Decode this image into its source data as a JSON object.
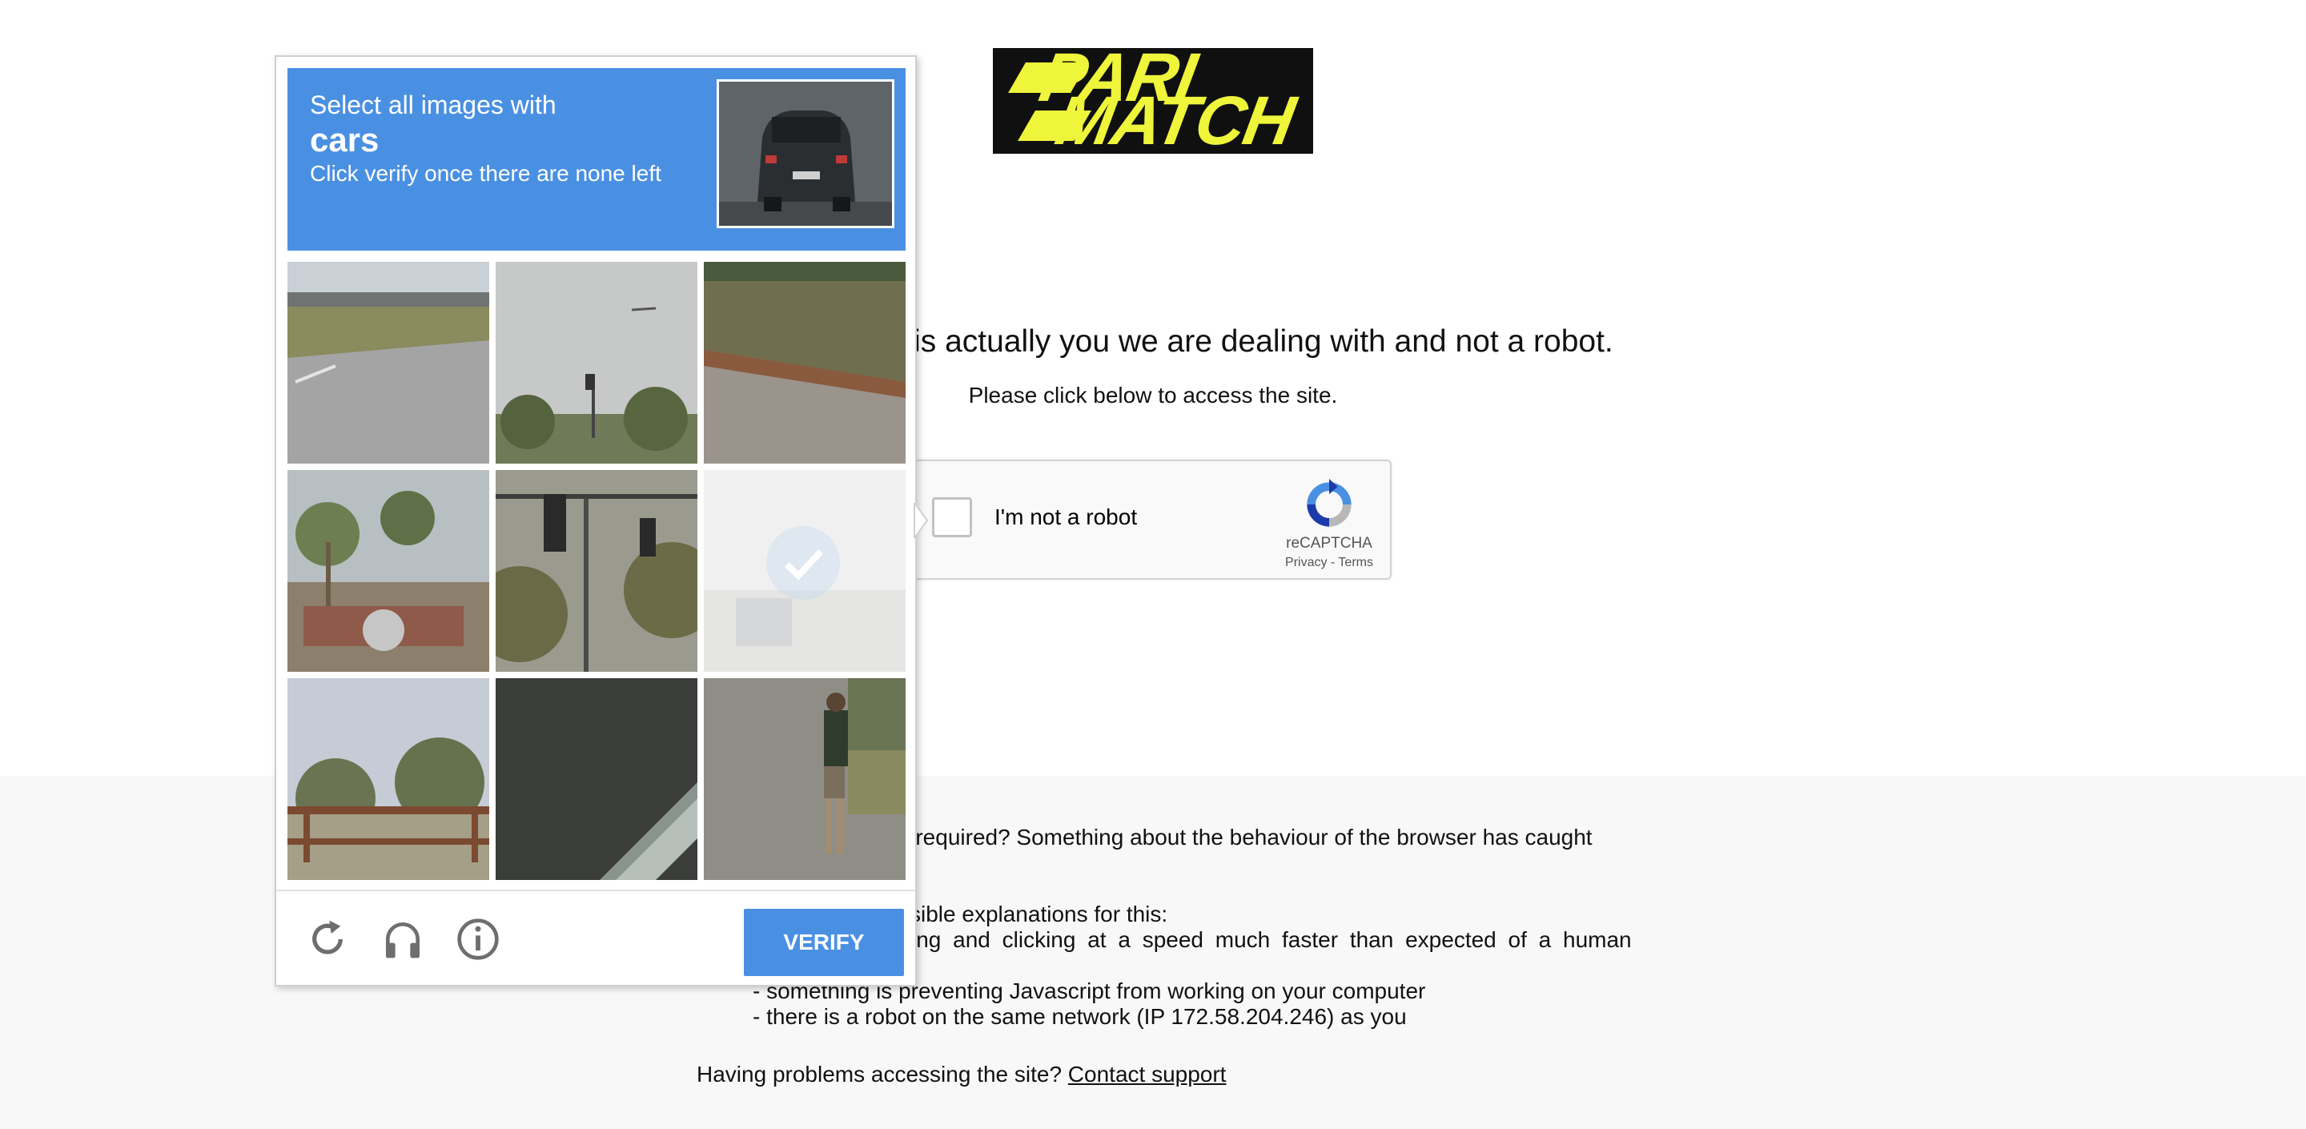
{
  "logo": {
    "line1": "PARI",
    "line2": "MATCH"
  },
  "page": {
    "heading_visible": "re it is actually you we are dealing with and not a robot.",
    "subheading": "Please click below to access the site."
  },
  "recaptcha_widget": {
    "label": "I'm not a robot",
    "brand": "reCAPTCHA",
    "links": "Privacy - Terms",
    "checked": false
  },
  "footer": {
    "why_line": "n required? Something about the behaviour of the browser has caught",
    "explanations_line": "sible explanations for this:",
    "reason1_partial": "ing and clicking at a speed much faster than expected of a human",
    "reason2": "- something is preventing Javascript from working on your computer",
    "reason3": "- there is a robot on the same network (IP 172.58.204.246) as you",
    "problems_text": "Having problems accessing the site?",
    "contact_link": "Contact support"
  },
  "challenge": {
    "prompt_line1": "Select all images with",
    "target": "cars",
    "prompt_line3": "Click verify once there are none left",
    "tiles": [
      {
        "id": 1,
        "scene": "road",
        "selected": false
      },
      {
        "id": 2,
        "scene": "sky-traffic-light",
        "selected": false
      },
      {
        "id": 3,
        "scene": "hedge-wall",
        "selected": false
      },
      {
        "id": 4,
        "scene": "palms",
        "selected": false
      },
      {
        "id": 5,
        "scene": "traffic-light-trees",
        "selected": false
      },
      {
        "id": 6,
        "scene": "blank-selected",
        "selected": true
      },
      {
        "id": 7,
        "scene": "fence-desert",
        "selected": false
      },
      {
        "id": 8,
        "scene": "dark-curb",
        "selected": false
      },
      {
        "id": 9,
        "scene": "person-sidewalk",
        "selected": false
      }
    ],
    "verify_label": "VERIFY",
    "icons": [
      "reload-icon",
      "audio-icon",
      "info-icon"
    ]
  },
  "colors": {
    "accent": "#4a90e2",
    "logo_yellow": "#eef53a",
    "logo_bg": "#101010",
    "footer_bg": "#f8f8f8"
  }
}
